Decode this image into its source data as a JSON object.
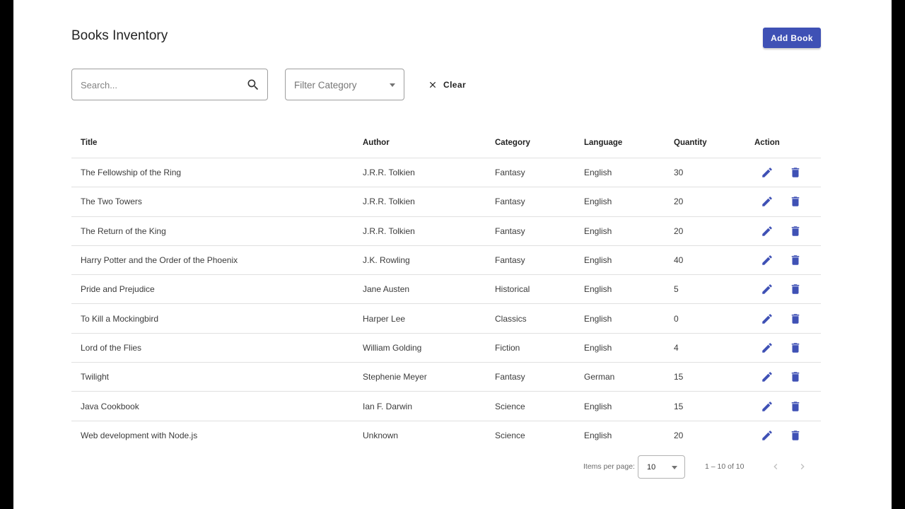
{
  "page": {
    "title": "Books Inventory",
    "add_button": "Add Book"
  },
  "toolbar": {
    "search_placeholder": "Search...",
    "filter_label": "Filter Category",
    "clear_label": "Clear"
  },
  "colors": {
    "primary": "#3f51b5",
    "background": "#ffffff",
    "frame": "#000000"
  },
  "icons": {
    "search": "search-icon",
    "clear": "close-icon",
    "edit": "pencil-icon",
    "delete": "trash-icon",
    "prev": "chevron-left-icon",
    "next": "chevron-right-icon",
    "dropdown": "caret-down-icon"
  },
  "table": {
    "columns": [
      "Title",
      "Author",
      "Category",
      "Language",
      "Quantity",
      "Action"
    ],
    "rows": [
      {
        "title": "The Fellowship of the Ring",
        "author": "J.R.R. Tolkien",
        "category": "Fantasy",
        "language": "English",
        "quantity": "30"
      },
      {
        "title": "The Two Towers",
        "author": "J.R.R. Tolkien",
        "category": "Fantasy",
        "language": "English",
        "quantity": "20"
      },
      {
        "title": "The Return of the King",
        "author": "J.R.R. Tolkien",
        "category": "Fantasy",
        "language": "English",
        "quantity": "20"
      },
      {
        "title": "Harry Potter and the Order of the Phoenix",
        "author": "J.K. Rowling",
        "category": "Fantasy",
        "language": "English",
        "quantity": "40"
      },
      {
        "title": "Pride and Prejudice",
        "author": "Jane Austen",
        "category": "Historical",
        "language": "English",
        "quantity": "5"
      },
      {
        "title": "To Kill a Mockingbird",
        "author": "Harper Lee",
        "category": "Classics",
        "language": "English",
        "quantity": "0"
      },
      {
        "title": "Lord of the Flies",
        "author": "William Golding",
        "category": "Fiction",
        "language": "English",
        "quantity": "4"
      },
      {
        "title": "Twilight",
        "author": "Stephenie Meyer",
        "category": "Fantasy",
        "language": "German",
        "quantity": "15"
      },
      {
        "title": "Java Cookbook",
        "author": "Ian F. Darwin",
        "category": "Science",
        "language": "English",
        "quantity": "15"
      },
      {
        "title": "Web development with Node.js",
        "author": "Unknown",
        "category": "Science",
        "language": "English",
        "quantity": "20"
      }
    ]
  },
  "paginator": {
    "items_per_page_label": "Items per page:",
    "page_size": "10",
    "range_label": "1 – 10 of 10"
  }
}
